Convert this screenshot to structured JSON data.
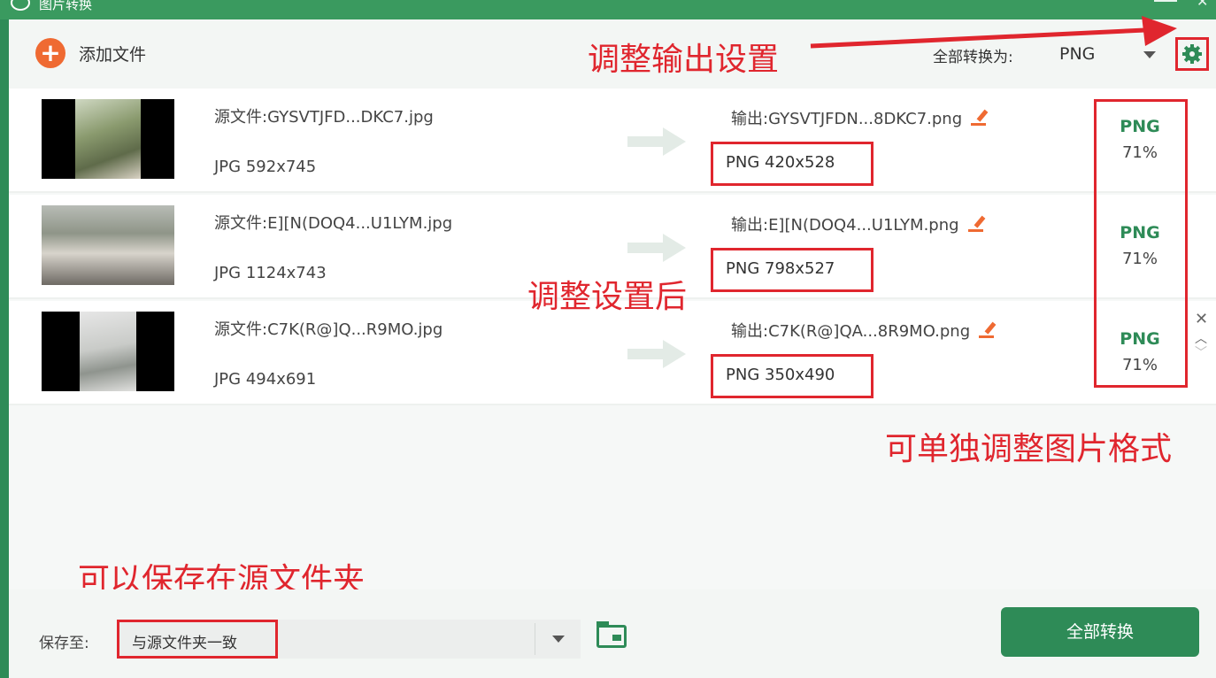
{
  "window": {
    "title": "图片转换"
  },
  "toolbar": {
    "add_label": "添加文件",
    "convert_all_label": "全部转换为:",
    "format_value": "PNG"
  },
  "files": [
    {
      "source_label": "源文件:GYSVTJFD...DKC7.jpg",
      "source_meta": "JPG  592x745",
      "output_label": "输出:GYSVTJFDN...8DKC7.png",
      "output_meta": "PNG  420x528",
      "format": "PNG",
      "quality": "71%"
    },
    {
      "source_label": "源文件:E][N(DOQ4...U1LYM.jpg",
      "source_meta": "JPG  1124x743",
      "output_label": "输出:E][N(DOQ4...U1LYM.png",
      "output_meta": "PNG  798x527",
      "format": "PNG",
      "quality": "71%"
    },
    {
      "source_label": "源文件:C7K(R@]Q...R9MO.jpg",
      "source_meta": "JPG  494x691",
      "output_label": "输出:C7K(R@]QA...8R9MO.png",
      "output_meta": "PNG  350x490",
      "format": "PNG",
      "quality": "71%"
    }
  ],
  "annotations": {
    "output_settings": "调整输出设置",
    "after_settings": "调整设置后",
    "individual_format": "可单独调整图片格式",
    "save_source_folder": "可以保存在源文件夹"
  },
  "bottom": {
    "save_label": "保存至:",
    "save_value": "与源文件夹一致",
    "convert_button": "全部转换"
  },
  "colors": {
    "accent": "#2e8b57",
    "annotation": "#e0262e",
    "add_button": "#ef6a32"
  },
  "icons": [
    "add-icon",
    "gear-icon",
    "arrow-right-icon",
    "edit-icon",
    "close-icon",
    "chevron-up-icon",
    "chevron-down-icon",
    "folder-icon"
  ]
}
